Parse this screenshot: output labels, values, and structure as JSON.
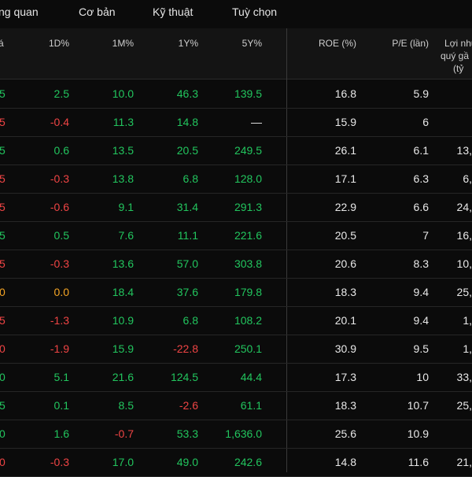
{
  "tabs": [
    "ng quan",
    "Cơ bản",
    "Kỹ thuật",
    "Tuỳ chọn"
  ],
  "headers": {
    "price": "á",
    "d1": "1D%",
    "m1": "1M%",
    "y1": "1Y%",
    "y5": "5Y%",
    "roe": "ROE (%)",
    "pe": "P/E (lần)",
    "profit_line1": "Lợi nhu",
    "profit_line2": "quý gầ",
    "profit_line3": "(tỷ"
  },
  "rows": [
    {
      "price": "5",
      "price_c": "pos",
      "d1": "2.5",
      "d1_c": "pos",
      "m1": "10.0",
      "m1_c": "pos",
      "y1": "46.3",
      "y1_c": "pos",
      "y5": "139.5",
      "y5_c": "pos",
      "roe": "16.8",
      "pe": "5.9",
      "profit": ""
    },
    {
      "price": "5",
      "price_c": "neg",
      "d1": "-0.4",
      "d1_c": "neg",
      "m1": "11.3",
      "m1_c": "pos",
      "y1": "14.8",
      "y1_c": "pos",
      "y5": "—",
      "y5_c": "wht",
      "roe": "15.9",
      "pe": "6",
      "profit": ""
    },
    {
      "price": "5",
      "price_c": "pos",
      "d1": "0.6",
      "d1_c": "pos",
      "m1": "13.5",
      "m1_c": "pos",
      "y1": "20.5",
      "y1_c": "pos",
      "y5": "249.5",
      "y5_c": "pos",
      "roe": "26.1",
      "pe": "6.1",
      "profit": "13,"
    },
    {
      "price": "5",
      "price_c": "neg",
      "d1": "-0.3",
      "d1_c": "neg",
      "m1": "13.8",
      "m1_c": "pos",
      "y1": "6.8",
      "y1_c": "pos",
      "y5": "128.0",
      "y5_c": "pos",
      "roe": "17.1",
      "pe": "6.3",
      "profit": "6,"
    },
    {
      "price": "5",
      "price_c": "neg",
      "d1": "-0.6",
      "d1_c": "neg",
      "m1": "9.1",
      "m1_c": "pos",
      "y1": "31.4",
      "y1_c": "pos",
      "y5": "291.3",
      "y5_c": "pos",
      "roe": "22.9",
      "pe": "6.6",
      "profit": "24,"
    },
    {
      "price": "5",
      "price_c": "pos",
      "d1": "0.5",
      "d1_c": "pos",
      "m1": "7.6",
      "m1_c": "pos",
      "y1": "11.1",
      "y1_c": "pos",
      "y5": "221.6",
      "y5_c": "pos",
      "roe": "20.5",
      "pe": "7",
      "profit": "16,"
    },
    {
      "price": "5",
      "price_c": "neg",
      "d1": "-0.3",
      "d1_c": "neg",
      "m1": "13.6",
      "m1_c": "pos",
      "y1": "57.0",
      "y1_c": "pos",
      "y5": "303.8",
      "y5_c": "pos",
      "roe": "20.6",
      "pe": "8.3",
      "profit": "10,"
    },
    {
      "price": "0",
      "price_c": "neu",
      "d1": "0.0",
      "d1_c": "neu",
      "m1": "18.4",
      "m1_c": "pos",
      "y1": "37.6",
      "y1_c": "pos",
      "y5": "179.8",
      "y5_c": "pos",
      "roe": "18.3",
      "pe": "9.4",
      "profit": "25,"
    },
    {
      "price": "5",
      "price_c": "neg",
      "d1": "-1.3",
      "d1_c": "neg",
      "m1": "10.9",
      "m1_c": "pos",
      "y1": "6.8",
      "y1_c": "pos",
      "y5": "108.2",
      "y5_c": "pos",
      "roe": "20.1",
      "pe": "9.4",
      "profit": "1,"
    },
    {
      "price": "0",
      "price_c": "neg",
      "d1": "-1.9",
      "d1_c": "neg",
      "m1": "15.9",
      "m1_c": "pos",
      "y1": "-22.8",
      "y1_c": "neg",
      "y5": "250.1",
      "y5_c": "pos",
      "roe": "30.9",
      "pe": "9.5",
      "profit": "1,"
    },
    {
      "price": "0",
      "price_c": "pos",
      "d1": "5.1",
      "d1_c": "pos",
      "m1": "21.6",
      "m1_c": "pos",
      "y1": "124.5",
      "y1_c": "pos",
      "y5": "44.4",
      "y5_c": "pos",
      "roe": "17.3",
      "pe": "10",
      "profit": "33,"
    },
    {
      "price": "5",
      "price_c": "pos",
      "d1": "0.1",
      "d1_c": "pos",
      "m1": "8.5",
      "m1_c": "pos",
      "y1": "-2.6",
      "y1_c": "neg",
      "y5": "61.1",
      "y5_c": "pos",
      "roe": "18.3",
      "pe": "10.7",
      "profit": "25,"
    },
    {
      "price": "0",
      "price_c": "pos",
      "d1": "1.6",
      "d1_c": "pos",
      "m1": "-0.7",
      "m1_c": "neg",
      "y1": "53.3",
      "y1_c": "pos",
      "y5": "1,636.0",
      "y5_c": "pos",
      "roe": "25.6",
      "pe": "10.9",
      "profit": ""
    },
    {
      "price": "0",
      "price_c": "neg",
      "d1": "-0.3",
      "d1_c": "neg",
      "m1": "17.0",
      "m1_c": "pos",
      "y1": "49.0",
      "y1_c": "pos",
      "y5": "242.6",
      "y5_c": "pos",
      "roe": "14.8",
      "pe": "11.6",
      "profit": "21,"
    }
  ]
}
